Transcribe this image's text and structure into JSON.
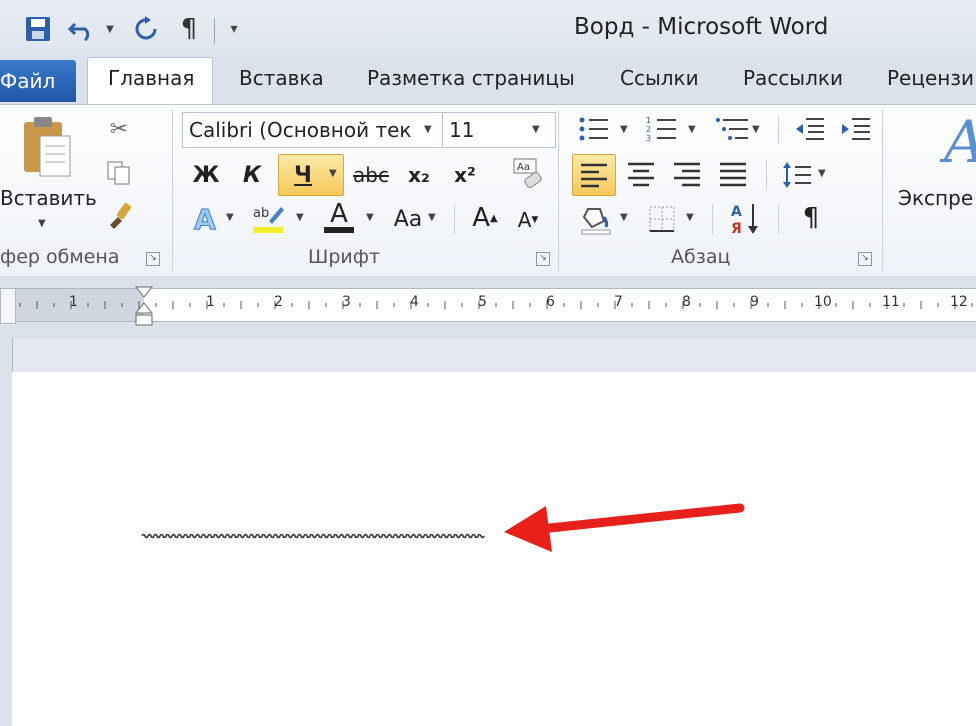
{
  "window": {
    "title": "Ворд  -  Microsoft Word"
  },
  "quick_access": {
    "save_icon": "save-icon",
    "undo_icon": "undo-icon",
    "redo_icon": "redo-icon",
    "pilcrow": "¶",
    "customize_icon": "customize-qat-icon"
  },
  "tabs": {
    "file": "Файл",
    "home": "Главная",
    "insert": "Вставка",
    "layout": "Разметка страницы",
    "references": "Ссылки",
    "mailings": "Рассылки",
    "review": "Рецензи"
  },
  "clipboard": {
    "paste_label": "Вставить",
    "group_label": "фер обмена"
  },
  "font": {
    "font_name": "Calibri (Основной тек",
    "font_size": "11",
    "bold": "Ж",
    "italic": "К",
    "underline": "Ч",
    "strike": "abc",
    "subscript": "x₂",
    "superscript": "x²",
    "change_case": "Aa",
    "grow": "A",
    "shrink": "A",
    "font_color": "A",
    "text_effects": "A",
    "group_label": "Шрифт"
  },
  "paragraph": {
    "group_label": "Абзац",
    "pilcrow": "¶"
  },
  "styles": {
    "express_label": "Экспре"
  },
  "ruler": {
    "left_numbers": [
      "1"
    ],
    "numbers": [
      "1",
      "2",
      "3",
      "4",
      "5",
      "6",
      "7",
      "8",
      "9",
      "10",
      "11",
      "12"
    ]
  },
  "document": {
    "annotation_color": "#e8201c",
    "squiggle_color": "#333333"
  }
}
